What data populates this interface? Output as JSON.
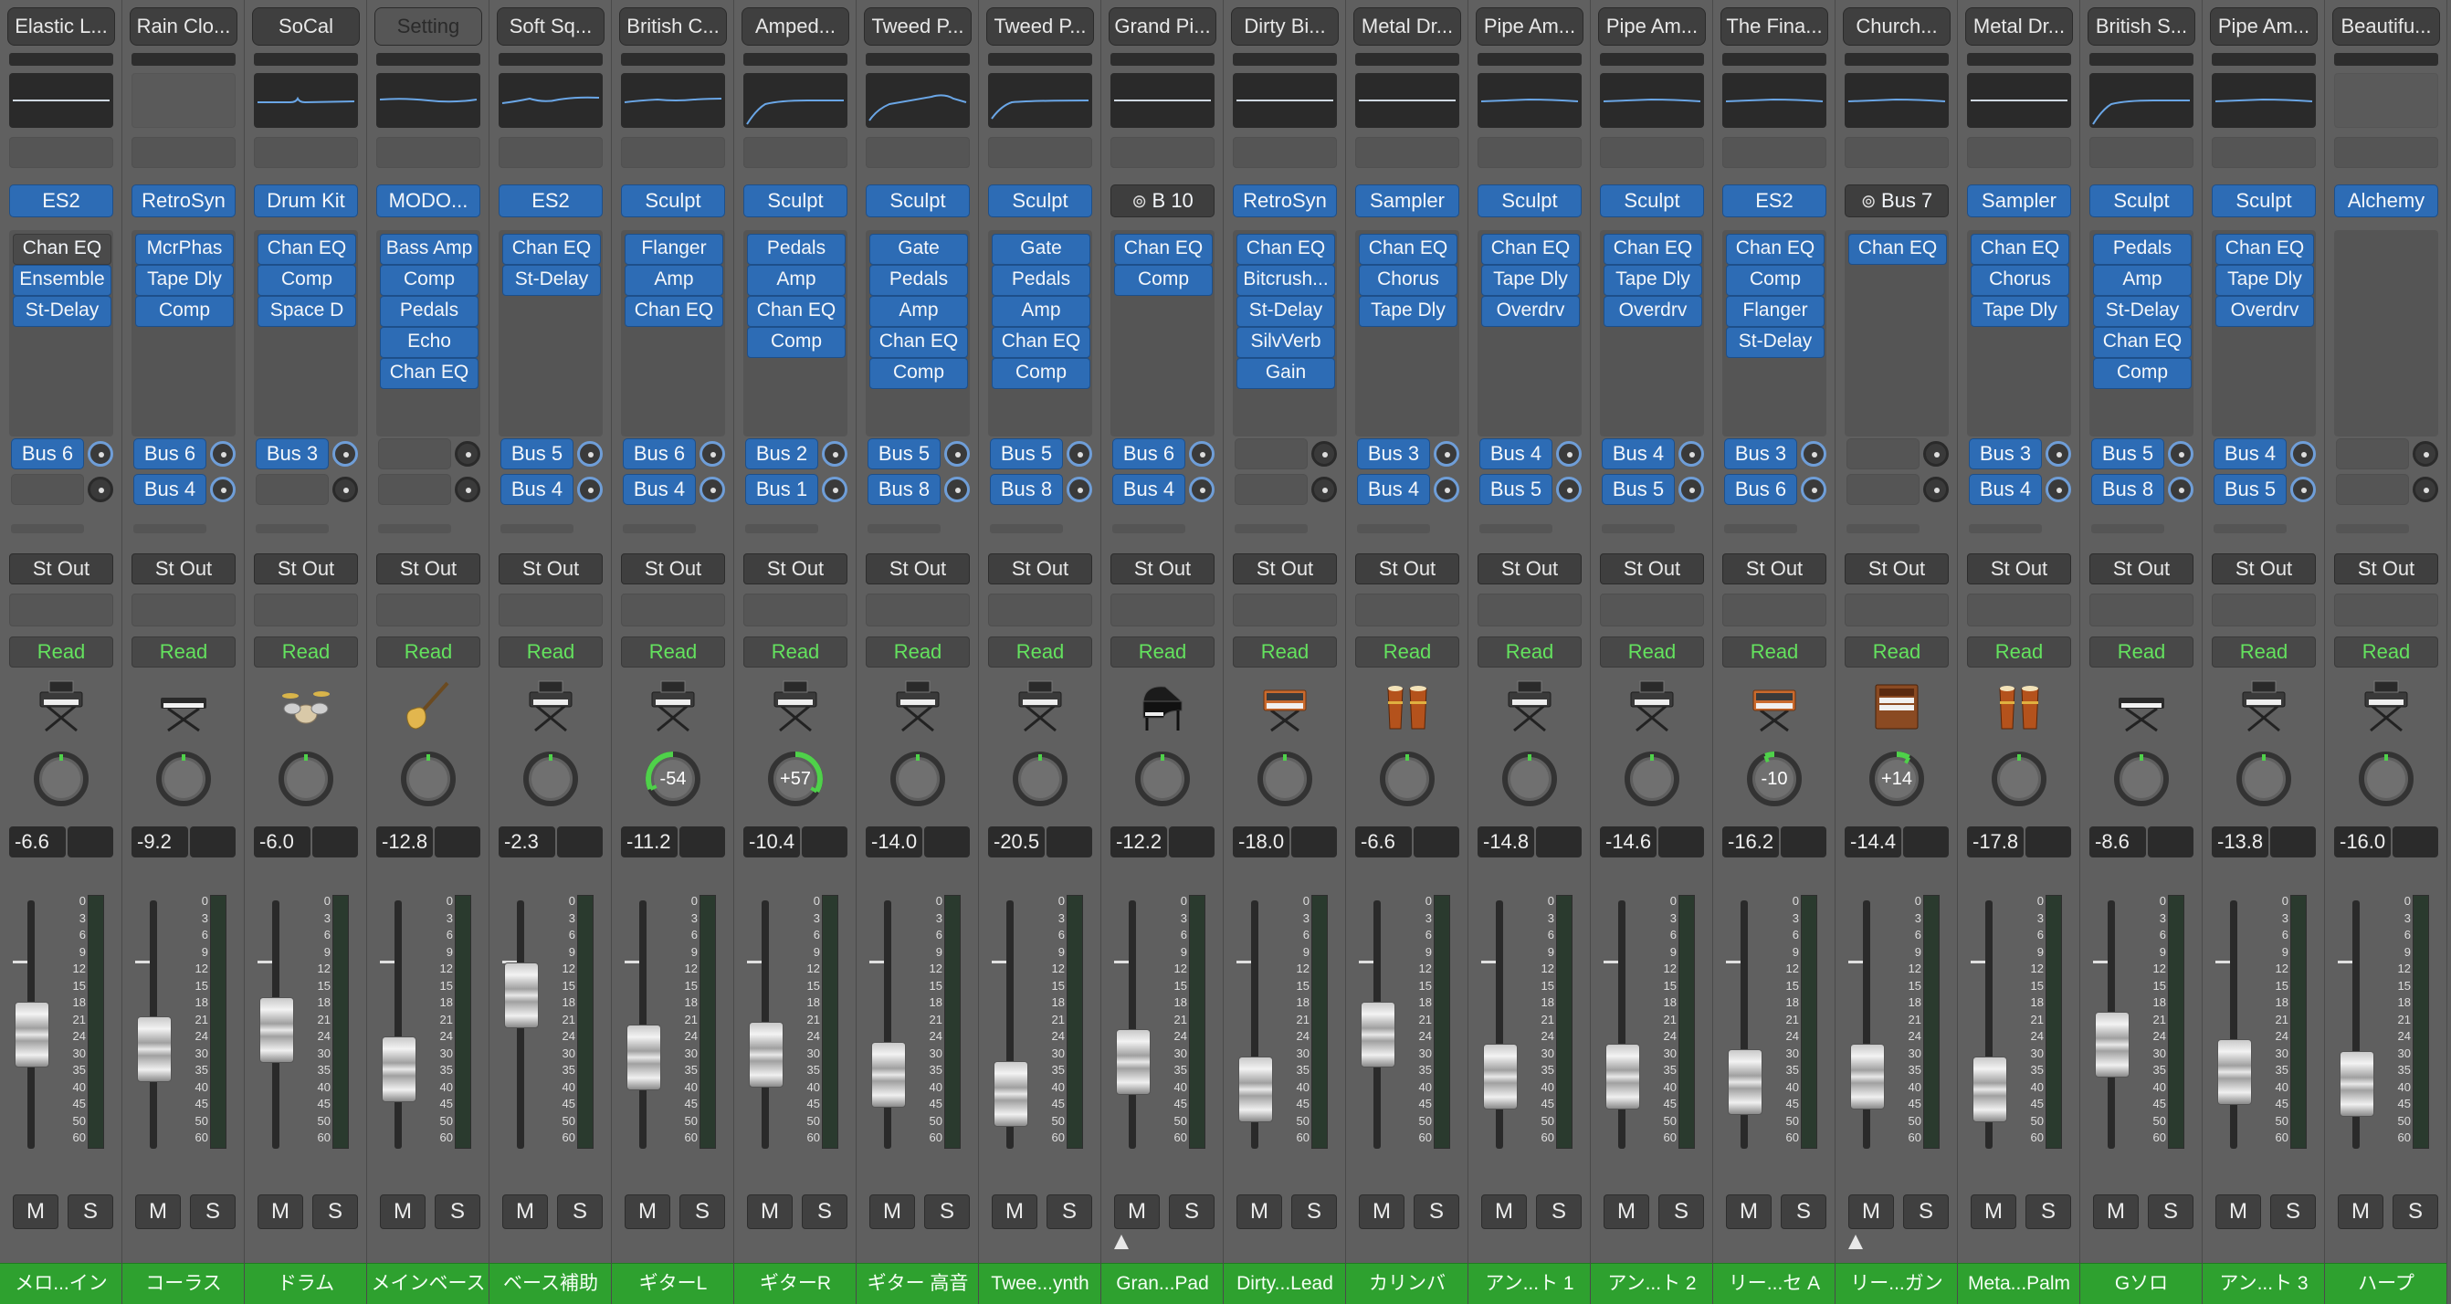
{
  "scale_labels": [
    "0",
    "3",
    "6",
    "9",
    "12",
    "15",
    "18",
    "21",
    "24",
    "30",
    "35",
    "40",
    "45",
    "50",
    "60"
  ],
  "colors": {
    "track_label": "#2ea12f",
    "automation_read": "#64e25e",
    "plugin_slot": "#2d6cb5",
    "pan_ring_active": "#4fd14a"
  },
  "strips": [
    {
      "name": "Elastic L...",
      "eq": "flat",
      "instrument": "ES2",
      "fx": [
        "Chan EQ",
        "Ensemble",
        "St-Delay"
      ],
      "fx_first_grey": true,
      "sends": [
        {
          "label": "Bus 6",
          "on": true
        },
        {
          "label": "",
          "on": false
        }
      ],
      "output": "St Out",
      "automation": "Read",
      "icon": "synth-icon",
      "pan": 0,
      "pan_label": "",
      "gain": "-6.6",
      "fader": 32,
      "label": "メロ...イン",
      "group": false
    },
    {
      "name": "Rain Clo...",
      "eq": "empty",
      "instrument": "RetroSyn",
      "fx": [
        "McrPhas",
        "Tape Dly",
        "Comp"
      ],
      "sends": [
        {
          "label": "Bus 6",
          "on": true
        },
        {
          "label": "Bus 4",
          "on": true
        }
      ],
      "output": "St Out",
      "automation": "Read",
      "icon": "keyboard-icon",
      "pan": 0,
      "pan_label": "",
      "gain": "-9.2",
      "fader": 38,
      "label": "コーラス",
      "group": false
    },
    {
      "name": "SoCal",
      "eq": "bump",
      "instrument": "Drum Kit",
      "fx": [
        "Chan EQ",
        "Comp",
        "Space D"
      ],
      "sends": [
        {
          "label": "Bus 3",
          "on": true
        },
        {
          "label": "",
          "on": false
        }
      ],
      "output": "St Out",
      "automation": "Read",
      "icon": "drums-icon",
      "pan": 0,
      "pan_label": "",
      "gain": "-6.0",
      "fader": 30,
      "label": "ドラム",
      "group": false
    },
    {
      "name": "Setting",
      "eq": "flat2",
      "instrument": "MODO...",
      "fx": [
        "Bass Amp",
        "Comp",
        "Pedals",
        "Echo",
        "Chan EQ"
      ],
      "sends": [
        {
          "label": "",
          "on": false
        },
        {
          "label": "",
          "on": false
        }
      ],
      "output": "St Out",
      "automation": "Read",
      "icon": "bass-guitar-icon",
      "pan": 0,
      "pan_label": "",
      "gain": "-12.8",
      "fader": 46,
      "label": "メインベース",
      "group": false
    },
    {
      "name": "Soft Sq...",
      "eq": "wave",
      "instrument": "ES2",
      "fx": [
        "Chan EQ",
        "St-Delay"
      ],
      "sends": [
        {
          "label": "Bus 5",
          "on": true
        },
        {
          "label": "Bus 4",
          "on": true
        }
      ],
      "output": "St Out",
      "automation": "Read",
      "icon": "synth-icon",
      "pan": 0,
      "pan_label": "",
      "gain": "-2.3",
      "fader": 16,
      "label": "ベース補助",
      "group": false
    },
    {
      "name": "British C...",
      "eq": "wave2",
      "instrument": "Sculpt",
      "fx": [
        "Flanger",
        "Amp",
        "Chan EQ"
      ],
      "sends": [
        {
          "label": "Bus 6",
          "on": true
        },
        {
          "label": "Bus 4",
          "on": true
        }
      ],
      "output": "St Out",
      "automation": "Read",
      "icon": "synth-icon",
      "pan": -54,
      "pan_label": "-54",
      "gain": "-11.2",
      "fader": 41,
      "label": "ギターL",
      "group": false
    },
    {
      "name": "Amped...",
      "eq": "lowcut",
      "instrument": "Sculpt",
      "fx": [
        "Pedals",
        "Amp",
        "Chan EQ",
        "Comp"
      ],
      "sends": [
        {
          "label": "Bus 2",
          "on": true
        },
        {
          "label": "Bus 1",
          "on": true
        }
      ],
      "output": "St Out",
      "automation": "Read",
      "icon": "synth-icon",
      "pan": 57,
      "pan_label": "+57",
      "gain": "-10.4",
      "fader": 40,
      "label": "ギターR",
      "group": false
    },
    {
      "name": "Tweed P...",
      "eq": "hump",
      "instrument": "Sculpt",
      "fx": [
        "Gate",
        "Pedals",
        "Amp",
        "Chan EQ",
        "Comp"
      ],
      "sends": [
        {
          "label": "Bus 5",
          "on": true
        },
        {
          "label": "Bus 8",
          "on": true
        }
      ],
      "output": "St Out",
      "automation": "Read",
      "icon": "synth-icon",
      "pan": 0,
      "pan_label": "",
      "gain": "-14.0",
      "fader": 48,
      "label": "ギター 高音",
      "group": false
    },
    {
      "name": "Tweed P...",
      "eq": "lowcut2",
      "instrument": "Sculpt",
      "fx": [
        "Gate",
        "Pedals",
        "Amp",
        "Chan EQ",
        "Comp"
      ],
      "sends": [
        {
          "label": "Bus 5",
          "on": true
        },
        {
          "label": "Bus 8",
          "on": true
        }
      ],
      "output": "St Out",
      "automation": "Read",
      "icon": "synth-icon",
      "pan": 0,
      "pan_label": "",
      "gain": "-20.5",
      "fader": 56,
      "label": "Twee...ynth",
      "group": false
    },
    {
      "name": "Grand Pi...",
      "eq": "flat",
      "instrument": "B 10",
      "instrument_bus": true,
      "fx": [
        "Chan EQ",
        "Comp"
      ],
      "sends": [
        {
          "label": "Bus 6",
          "on": true
        },
        {
          "label": "Bus 4",
          "on": true
        }
      ],
      "output": "St Out",
      "automation": "Read",
      "icon": "grand-piano-icon",
      "pan": 0,
      "pan_label": "",
      "gain": "-12.2",
      "fader": 43,
      "label": "Gran...Pad",
      "group": true
    },
    {
      "name": "Dirty Bi...",
      "eq": "flat",
      "instrument": "RetroSyn",
      "fx": [
        "Chan EQ",
        "Bitcrush...",
        "St-Delay",
        "SilvVerb",
        "Gain"
      ],
      "sends": [
        {
          "label": "",
          "on": false
        },
        {
          "label": "",
          "on": false
        }
      ],
      "output": "St Out",
      "automation": "Read",
      "icon": "vintage-synth-icon",
      "pan": 0,
      "pan_label": "",
      "gain": "-18.0",
      "fader": 54,
      "label": "Dirty...Lead",
      "group": false
    },
    {
      "name": "Metal Dr...",
      "eq": "flat",
      "instrument": "Sampler",
      "fx": [
        "Chan EQ",
        "Chorus",
        "Tape Dly"
      ],
      "sends": [
        {
          "label": "Bus 3",
          "on": true
        },
        {
          "label": "Bus 4",
          "on": true
        }
      ],
      "output": "St Out",
      "automation": "Read",
      "icon": "congas-icon",
      "pan": 0,
      "pan_label": "",
      "gain": "-6.6",
      "fader": 32,
      "label": "カリンバ",
      "group": false
    },
    {
      "name": "Pipe Am...",
      "eq": "wave3",
      "instrument": "Sculpt",
      "fx": [
        "Chan EQ",
        "Tape Dly",
        "Overdrv"
      ],
      "sends": [
        {
          "label": "Bus 4",
          "on": true
        },
        {
          "label": "Bus 5",
          "on": true
        }
      ],
      "output": "St Out",
      "automation": "Read",
      "icon": "synth-icon",
      "pan": 0,
      "pan_label": "",
      "gain": "-14.8",
      "fader": 49,
      "label": "アン...ト 1",
      "group": false
    },
    {
      "name": "Pipe Am...",
      "eq": "wave3",
      "instrument": "Sculpt",
      "fx": [
        "Chan EQ",
        "Tape Dly",
        "Overdrv"
      ],
      "sends": [
        {
          "label": "Bus 4",
          "on": true
        },
        {
          "label": "Bus 5",
          "on": true
        }
      ],
      "output": "St Out",
      "automation": "Read",
      "icon": "synth-icon",
      "pan": 0,
      "pan_label": "",
      "gain": "-14.6",
      "fader": 49,
      "label": "アン...ト 2",
      "group": false
    },
    {
      "name": "The Fina...",
      "eq": "wave3",
      "instrument": "ES2",
      "fx": [
        "Chan EQ",
        "Comp",
        "Flanger",
        "St-Delay"
      ],
      "sends": [
        {
          "label": "Bus 3",
          "on": true
        },
        {
          "label": "Bus 6",
          "on": true
        }
      ],
      "output": "St Out",
      "automation": "Read",
      "icon": "vintage-synth-icon",
      "pan": -10,
      "pan_label": "-10",
      "gain": "-16.2",
      "fader": 51,
      "label": "リー...セ A",
      "group": false
    },
    {
      "name": "Church...",
      "eq": "wave3",
      "instrument": "Bus 7",
      "instrument_bus": true,
      "fx": [
        "Chan EQ"
      ],
      "sends": [
        {
          "label": "",
          "on": false
        },
        {
          "label": "",
          "on": false
        }
      ],
      "output": "St Out",
      "automation": "Read",
      "icon": "organ-icon",
      "pan": 14,
      "pan_label": "+14",
      "gain": "-14.4",
      "fader": 49,
      "label": "リー...ガン",
      "group": true
    },
    {
      "name": "Metal Dr...",
      "eq": "flat",
      "instrument": "Sampler",
      "fx": [
        "Chan EQ",
        "Chorus",
        "Tape Dly"
      ],
      "sends": [
        {
          "label": "Bus 3",
          "on": true
        },
        {
          "label": "Bus 4",
          "on": true
        }
      ],
      "output": "St Out",
      "automation": "Read",
      "icon": "congas-icon",
      "pan": 0,
      "pan_label": "",
      "gain": "-17.8",
      "fader": 54,
      "label": "Meta...Palm",
      "group": false
    },
    {
      "name": "British S...",
      "eq": "lowcut",
      "instrument": "Sculpt",
      "fx": [
        "Pedals",
        "Amp",
        "St-Delay",
        "Chan EQ",
        "Comp"
      ],
      "sends": [
        {
          "label": "Bus 5",
          "on": true
        },
        {
          "label": "Bus 8",
          "on": true
        }
      ],
      "output": "St Out",
      "automation": "Read",
      "icon": "keyboard-icon",
      "pan": 0,
      "pan_label": "",
      "gain": "-8.6",
      "fader": 36,
      "label": "Gソロ",
      "group": false
    },
    {
      "name": "Pipe Am...",
      "eq": "wave3",
      "instrument": "Sculpt",
      "fx": [
        "Chan EQ",
        "Tape Dly",
        "Overdrv"
      ],
      "sends": [
        {
          "label": "Bus 4",
          "on": true
        },
        {
          "label": "Bus 5",
          "on": true
        }
      ],
      "output": "St Out",
      "automation": "Read",
      "icon": "synth-icon",
      "pan": 0,
      "pan_label": "",
      "gain": "-13.8",
      "fader": 47,
      "label": "アン...ト 3",
      "group": false
    },
    {
      "name": "Beautifu...",
      "eq": "empty",
      "instrument": "Alchemy",
      "fx": [],
      "sends": [
        {
          "label": "",
          "on": false
        },
        {
          "label": "",
          "on": false
        }
      ],
      "output": "St Out",
      "automation": "Read",
      "icon": "synth-keyboard-icon",
      "pan": 0,
      "pan_label": "",
      "gain": "-16.0",
      "fader": 52,
      "label": "ハープ",
      "group": false
    }
  ]
}
